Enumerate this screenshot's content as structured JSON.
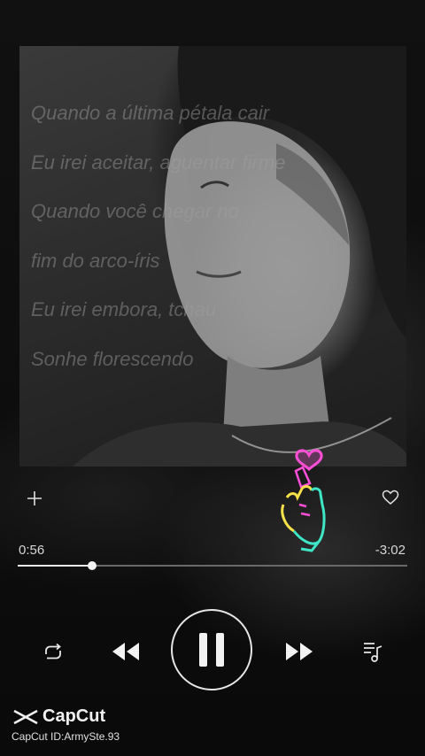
{
  "lyrics": [
    "Quando a última pétala cair",
    "Eu irei aceitar, aguentar firme",
    "Quando você chegar no",
    "fim do arco-íris",
    "Eu irei embora, tchau",
    "Sonhe florescendo"
  ],
  "player": {
    "elapsed": "0:56",
    "remaining": "-3:02",
    "progress": 0.19
  },
  "watermark": {
    "brand": "CapCut",
    "id_text": "CapCut ID:ArmySte.93"
  },
  "icons": {
    "add": "plus-icon",
    "like": "heart-icon",
    "sticker": "finger-heart-icon",
    "repeat": "repeat-icon",
    "previous": "rewind-icon",
    "pause": "pause-icon",
    "next": "fast-forward-icon",
    "queue": "playlist-icon"
  },
  "colors": {
    "accent": "#e8e8e8",
    "neon_pink": "#ff4fd8",
    "neon_yellow": "#f5e04a",
    "neon_teal": "#3ee6c6"
  }
}
